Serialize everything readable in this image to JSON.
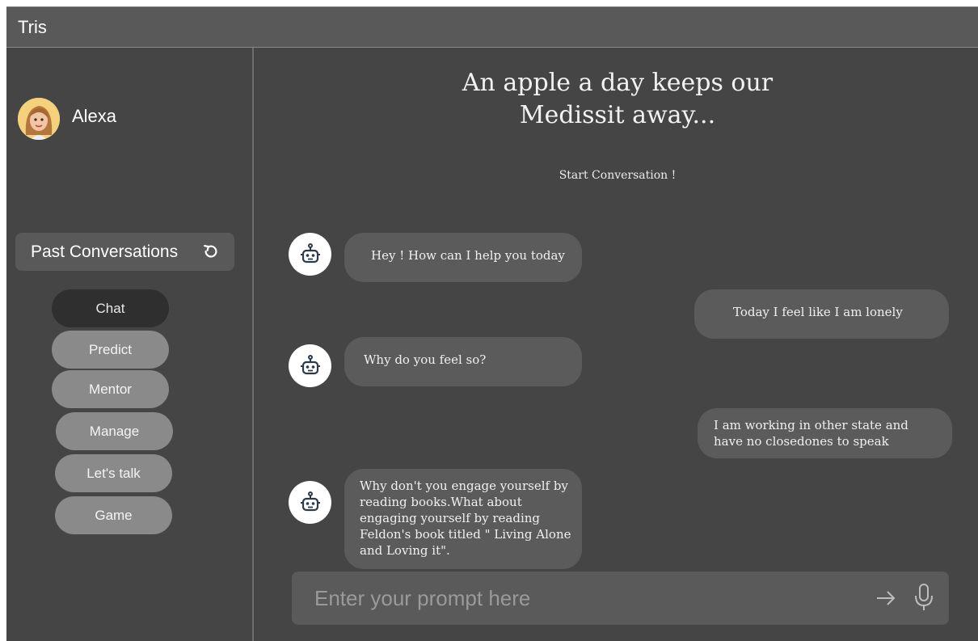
{
  "window": {
    "title": "Tris"
  },
  "sidebar": {
    "user_name": "Alexa",
    "past_conversations_label": "Past Conversations",
    "nav_items": [
      {
        "label": "Chat",
        "active": true
      },
      {
        "label": "Predict",
        "active": false
      },
      {
        "label": "Mentor",
        "active": false
      },
      {
        "label": "Manage",
        "active": false
      },
      {
        "label": "Let's talk",
        "active": false
      },
      {
        "label": "Game",
        "active": false
      }
    ]
  },
  "main": {
    "tagline_line1": "An apple a day keeps our",
    "tagline_line2": "Medissit away...",
    "start_label": "Start Conversation !",
    "messages": [
      {
        "sender": "bot",
        "text": "Hey ! How can I help you today"
      },
      {
        "sender": "user",
        "text": "Today I feel like I am lonely"
      },
      {
        "sender": "bot",
        "text": "Why do you feel so?"
      },
      {
        "sender": "user",
        "text": "I am working in other state and have no closedones to speak"
      },
      {
        "sender": "bot",
        "text": "Why don't you engage yourself by reading books.What about engaging yourself by reading Feldon's book titled \" Living Alone and Loving it\"."
      }
    ],
    "input_placeholder": "Enter your prompt here",
    "input_value": ""
  },
  "icons": {
    "refresh": "refresh-icon",
    "bot": "robot-icon",
    "send": "arrow-right-icon",
    "mic": "microphone-icon",
    "avatar": "memoji-avatar"
  },
  "colors": {
    "background": "#454545",
    "titlebar": "#595959",
    "bubble": "#5b5b5b",
    "nav_button": "#8a8a8a",
    "nav_button_active": "#2f2f2f"
  }
}
